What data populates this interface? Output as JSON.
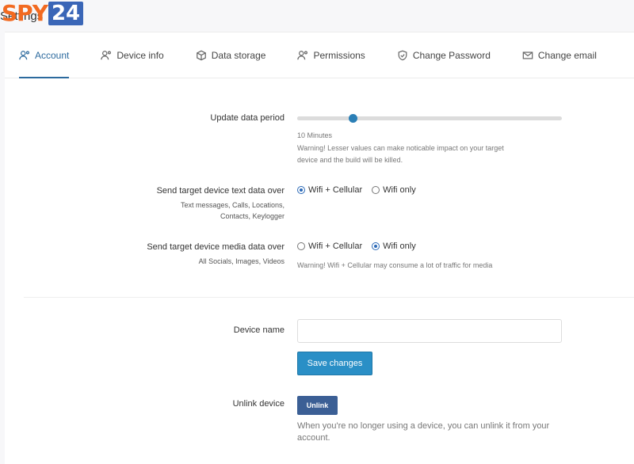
{
  "logo": {
    "spy": "SPY",
    "num": "24"
  },
  "page_title": "Settings",
  "tabs": [
    {
      "label": "Account",
      "icon": "user-gear-icon",
      "active": true
    },
    {
      "label": "Device info",
      "icon": "user-gear-icon",
      "active": false
    },
    {
      "label": "Data storage",
      "icon": "box-icon",
      "active": false
    },
    {
      "label": "Permissions",
      "icon": "user-gear-icon",
      "active": false
    },
    {
      "label": "Change Password",
      "icon": "shield-icon",
      "active": false
    },
    {
      "label": "Change email",
      "icon": "envelope-icon",
      "active": false
    }
  ],
  "update_period": {
    "label": "Update data period",
    "value_text": "10 Minutes",
    "level": 0.21,
    "warning_line1": "Warning! Lesser values can make noticable impact on your target",
    "warning_line2": "device and the build will be killed."
  },
  "text_data": {
    "label": "Send target device text data over",
    "sub_line1": "Text messages, Calls, Locations,",
    "sub_line2": "Contacts, Keylogger",
    "options": [
      "Wifi + Cellular",
      "Wifi only"
    ],
    "selected": 0
  },
  "media_data": {
    "label": "Send target device media data over",
    "sub": "All Socials, Images, Videos",
    "options": [
      "Wifi + Cellular",
      "Wifi only"
    ],
    "selected": 1,
    "warning": "Warning! Wifi + Cellular may consume a lot of traffic for media"
  },
  "device_name": {
    "label": "Device name",
    "value": "",
    "placeholder": ""
  },
  "save_button": "Save changes",
  "unlink": {
    "label": "Unlink device",
    "button": "Unlink",
    "note_line1": "When you're no longer using a device, you can unlink it from your",
    "note_line2": "account."
  },
  "colors": {
    "accent": "#2c6a9e",
    "save": "#2a8fc6",
    "unlink": "#3b5f95",
    "logo_orange": "#f26a21",
    "logo_blue": "#3a66b7"
  }
}
